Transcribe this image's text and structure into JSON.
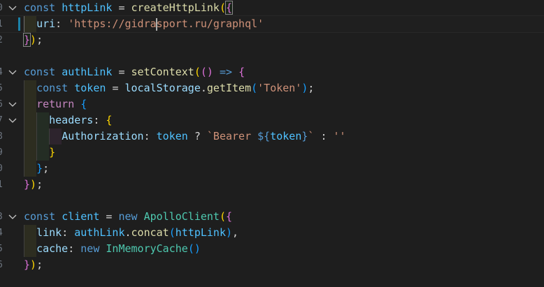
{
  "editor": {
    "line_numbers": {
      "l1": "0",
      "l2": "1",
      "l3": "2",
      "l5": "4",
      "l6": "5",
      "l7": "6",
      "l8": "7",
      "l9": "8",
      "l10": "9",
      "l11": "0",
      "l12": "1",
      "l14": "3",
      "l15": "4",
      "l16": "5",
      "l17": "6"
    },
    "tokens": {
      "const": "const",
      "return": "return",
      "new": "new",
      "httpLink": "httpLink",
      "authLink": "authLink",
      "client": "client",
      "token": "token",
      "createHttpLink": "createHttpLink",
      "setContext": "setContext",
      "ApolloClient": "ApolloClient",
      "InMemoryCache": "InMemoryCache",
      "localStorage": "localStorage",
      "getItem": "getItem",
      "concat": "concat",
      "uri": "uri",
      "headers": "headers",
      "Authorization": "Authorization",
      "link": "link",
      "cache": "cache",
      "uri_value_part1": "'https://gidra",
      "uri_value_part2": "sport.ru/graphql'",
      "token_key": "'Token'",
      "bearer_open": "`Bearer ",
      "bearer_close": "`",
      "empty_string": "''",
      "arrow": "=>"
    }
  },
  "colors": {
    "background": "#1e1e1e",
    "keyword": "#569cd6",
    "control": "#c586c0",
    "variable": "#4fc1ff",
    "property": "#9cdcfe",
    "function": "#dcdcaa",
    "class": "#4ec9b0",
    "string": "#ce9178",
    "bracket_level1": "#ffd700",
    "bracket_level2": "#da70d6",
    "bracket_level3": "#179fff"
  }
}
